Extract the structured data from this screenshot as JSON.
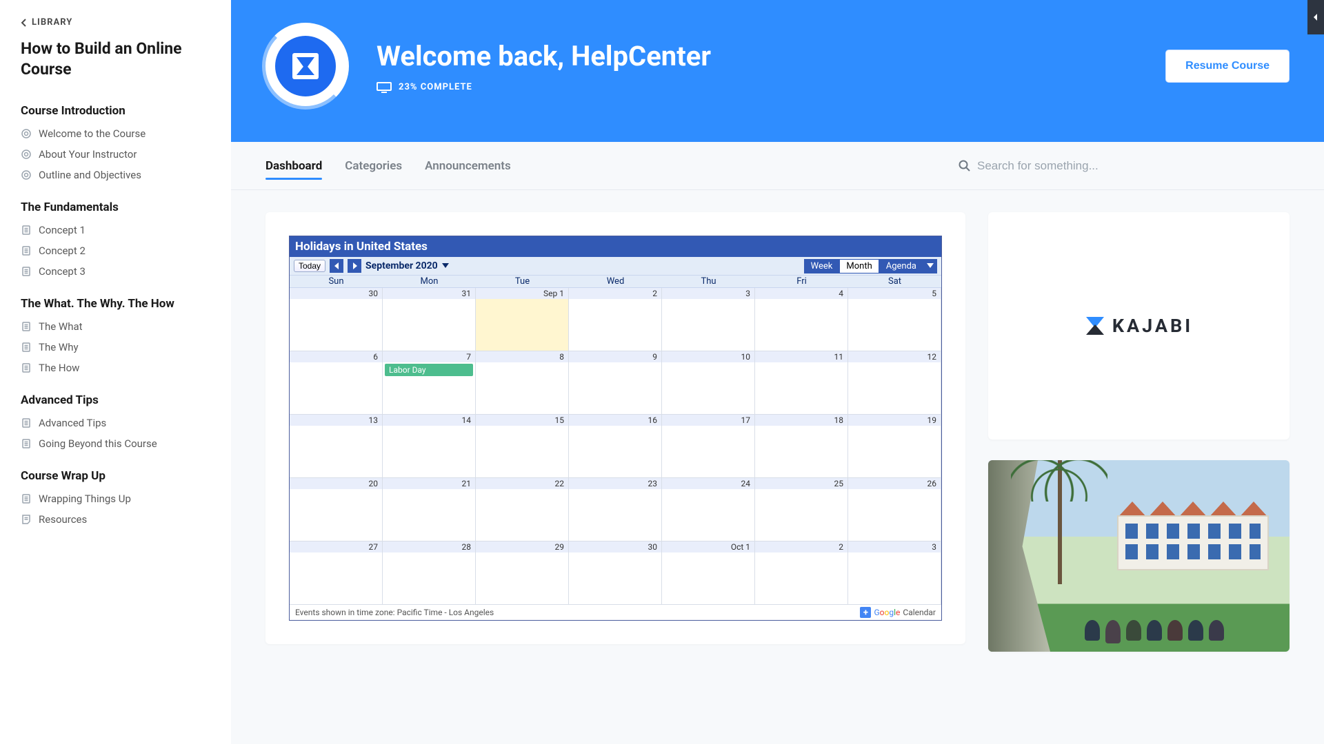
{
  "sidebar": {
    "library_label": "LIBRARY",
    "course_title": "How to Build an Online Course",
    "sections": [
      {
        "title": "Course Introduction",
        "items": [
          {
            "label": "Welcome to the Course",
            "icon": "target"
          },
          {
            "label": "About Your Instructor",
            "icon": "target"
          },
          {
            "label": "Outline and Objectives",
            "icon": "target"
          }
        ]
      },
      {
        "title": "The Fundamentals",
        "items": [
          {
            "label": "Concept 1",
            "icon": "doc"
          },
          {
            "label": "Concept 2",
            "icon": "doc"
          },
          {
            "label": "Concept 3",
            "icon": "doc"
          }
        ]
      },
      {
        "title": "The What. The Why. The How",
        "items": [
          {
            "label": "The What",
            "icon": "doc"
          },
          {
            "label": "The Why",
            "icon": "doc"
          },
          {
            "label": "The How",
            "icon": "doc"
          }
        ]
      },
      {
        "title": "Advanced Tips",
        "items": [
          {
            "label": "Advanced Tips",
            "icon": "doc"
          },
          {
            "label": "Going Beyond this Course",
            "icon": "doc"
          }
        ]
      },
      {
        "title": "Course Wrap Up",
        "items": [
          {
            "label": "Wrapping Things Up",
            "icon": "doc"
          },
          {
            "label": "Resources",
            "icon": "note"
          }
        ]
      }
    ]
  },
  "hero": {
    "welcome": "Welcome back, HelpCenter",
    "progress_text": "23% COMPLETE",
    "resume_label": "Resume Course"
  },
  "tabs": {
    "items": [
      "Dashboard",
      "Categories",
      "Announcements"
    ],
    "active_index": 0
  },
  "search": {
    "placeholder": "Search for something..."
  },
  "calendar": {
    "title": "Holidays in United States",
    "today_label": "Today",
    "month_label": "September 2020",
    "views": [
      "Week",
      "Month",
      "Agenda"
    ],
    "active_view_index": 1,
    "dow": [
      "Sun",
      "Mon",
      "Tue",
      "Wed",
      "Thu",
      "Fri",
      "Sat"
    ],
    "weeks": [
      [
        "30",
        "31",
        "Sep 1",
        "2",
        "3",
        "4",
        "5"
      ],
      [
        "6",
        "7",
        "8",
        "9",
        "10",
        "11",
        "12"
      ],
      [
        "13",
        "14",
        "15",
        "16",
        "17",
        "18",
        "19"
      ],
      [
        "20",
        "21",
        "22",
        "23",
        "24",
        "25",
        "26"
      ],
      [
        "27",
        "28",
        "29",
        "30",
        "Oct 1",
        "2",
        "3"
      ]
    ],
    "today_cell": [
      0,
      2
    ],
    "events": [
      {
        "week": 1,
        "day": 1,
        "label": "Labor Day"
      }
    ],
    "other_month_cells": [
      [
        0,
        0
      ],
      [
        0,
        1
      ],
      [
        4,
        4
      ],
      [
        4,
        5
      ],
      [
        4,
        6
      ]
    ],
    "timezone_text": "Events shown in time zone: Pacific Time - Los Angeles",
    "brand_text": "Calendar"
  },
  "side_brand": "KAJABI"
}
